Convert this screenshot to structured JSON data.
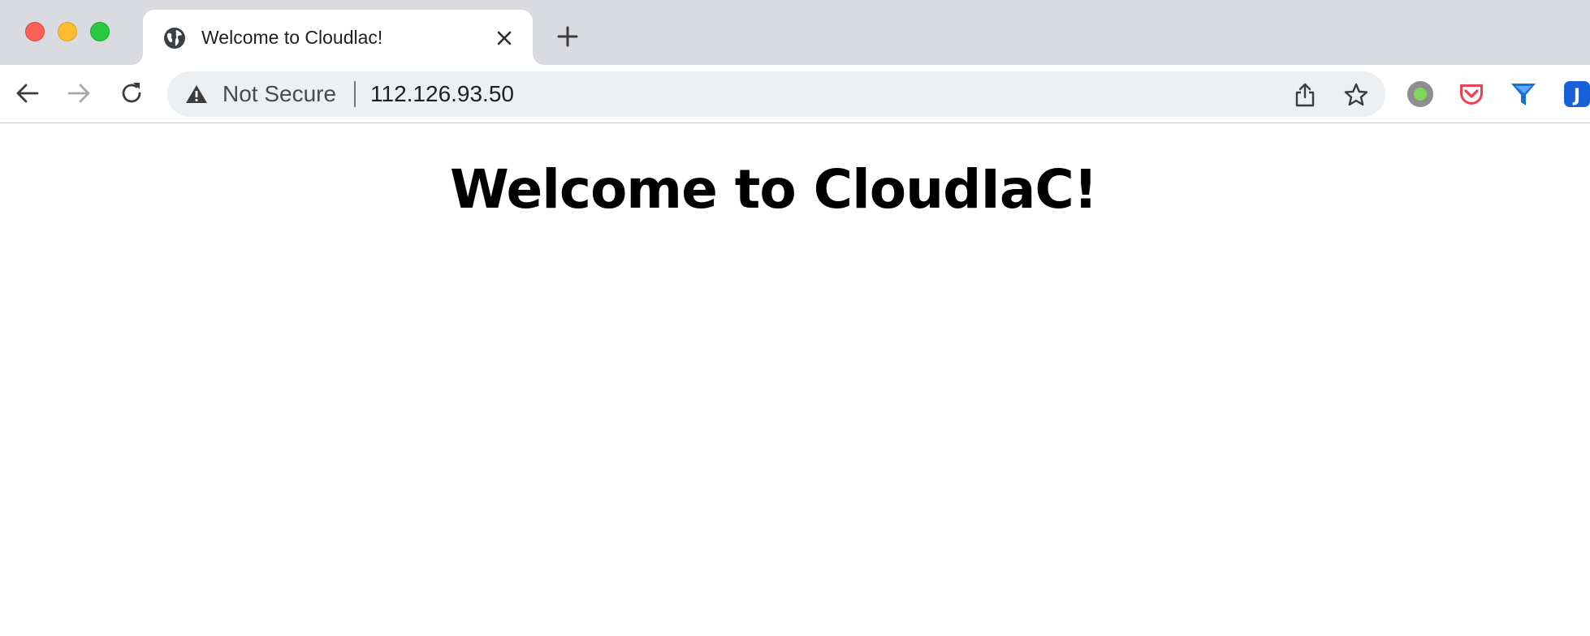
{
  "browser": {
    "tab": {
      "title": "Welcome to Cloudlac!",
      "favicon": "globe-icon",
      "close_icon": "close-icon"
    },
    "new_tab_icon": "plus-icon",
    "toolbar": {
      "back_icon": "arrow-left-icon",
      "forward_icon": "arrow-right-icon",
      "reload_icon": "reload-icon",
      "security_icon": "warning-triangle-icon",
      "security_label": "Not Secure",
      "url": "112.126.93.50",
      "share_icon": "share-icon",
      "bookmark_icon": "star-icon",
      "extensions": [
        "status-dot-extension-icon",
        "pocket-extension-icon",
        "funnel-extension-icon",
        "jd-extension-icon"
      ]
    },
    "colors": {
      "tabstrip": "#d9dbe0",
      "omnibox": "#edf0f2",
      "pocket": "#ef3f56",
      "funnel": "#1a6fd8"
    }
  },
  "page": {
    "heading": "Welcome to CloudIaC!"
  }
}
